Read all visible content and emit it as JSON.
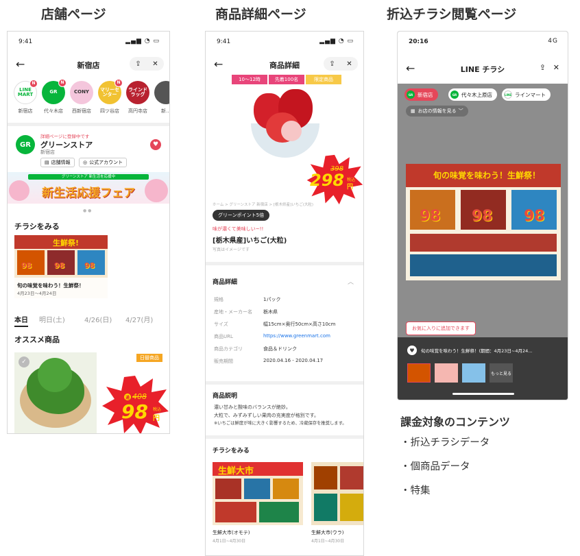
{
  "headers": {
    "store_page": "店舗ページ",
    "detail_page": "商品詳細ページ",
    "flyer_page": "折込チラシ閲覧ページ"
  },
  "store_page": {
    "status_time": "9:41",
    "title": "新宿店",
    "stores": [
      {
        "name": "LINE MART",
        "label": "新宿店",
        "color": "#ffffff",
        "text_color": "#07b53b",
        "badge": "N"
      },
      {
        "name": "GR",
        "label": "代々木店",
        "color": "#07b53b",
        "text_color": "#ffffff",
        "badge": "N"
      },
      {
        "name": "CONY",
        "label": "西新宿店",
        "color": "#f4c6dc",
        "text_color": "#333333",
        "badge": ""
      },
      {
        "name": "マリーセンター",
        "label": "四ツ谷店",
        "color": "#f1c232",
        "text_color": "#ffffff",
        "badge": "N"
      },
      {
        "name": "ラインドラッグ",
        "label": "高円寺店",
        "color": "#b8212f",
        "text_color": "#ffffff",
        "badge": ""
      },
      {
        "name": "",
        "label": "新…",
        "color": "#555555",
        "text_color": "#ffffff",
        "badge": ""
      }
    ],
    "shop_small": "詳細ページに登録中です",
    "shop_name": "グリーンストア",
    "shop_branch": "新宿店",
    "btn_store_info": "店舗情報",
    "btn_official": "公式アカウント",
    "banner_top": "グリーンストア 新生活を応援中",
    "banner_main": "新生活応援フェア",
    "flyer_section": "チラシをみる",
    "flyer_title": "旬の味覚を味わう！生鮮祭！",
    "flyer_dates": "4月23日～4月24日",
    "date_tabs": [
      "本日",
      "明日(土)",
      "4/26(日)",
      "4/27(月)"
    ],
    "recommend_section": "オススメ商品",
    "recommend_tag": "日替商品",
    "price_old": "408",
    "price_new": "98",
    "price_unit": "円",
    "tax_label": "税込"
  },
  "detail_page": {
    "status_time": "9:41",
    "title": "商品詳細",
    "tags": [
      "10～12時",
      "先着100名",
      "限定商品"
    ],
    "price_old": "398",
    "price_new": "298",
    "price_unit": "円",
    "tax_label": "税込",
    "breadcrumb": "ホーム > グリーンストア 新宿店 > [栃木県産]いちご(大粒)",
    "point_tag": "グリーンポイント5倍",
    "catch_copy": "味が濃くて美味しい~!!",
    "product_name": "[栃木県産]いちご(大粒)",
    "image_note": "写真はイメージです",
    "details_head": "商品詳細",
    "details": [
      {
        "k": "規格",
        "v": "1パック",
        "link": false
      },
      {
        "k": "産地・メーカー名",
        "v": "栃木県",
        "link": false
      },
      {
        "k": "サイズ",
        "v": "幅15cm×奥行50cm×高さ10cm",
        "link": false
      },
      {
        "k": "商品URL",
        "v": "https://www.greenmart.com",
        "link": true
      },
      {
        "k": "商品カテゴリ",
        "v": "食品＆ドリンク",
        "link": false
      },
      {
        "k": "販売期間",
        "v": "2020.04.16 - 2020.04.17",
        "link": false
      }
    ],
    "desc_head": "商品説明",
    "desc_lines": [
      "濃い甘みと酸味のバランスが絶妙。",
      "大粒で、みずみずしい果肉の充実度が格別です。",
      "※いちごは鮮度が味に大きく影響するため、冷蔵保存を推奨します。"
    ],
    "flyer_section": "チラシをみる",
    "flyers": [
      {
        "banner": "生鮮大市",
        "name": "生鮮大市(オモテ)",
        "dates": "4月1日~4月30日"
      },
      {
        "banner": "",
        "name": "生鮮大市(ウラ)",
        "dates": "4月1日~4月30日"
      }
    ]
  },
  "flyer_page": {
    "status_time": "20:16",
    "status_right": "4G",
    "title": "LINE チラシ",
    "chips": [
      {
        "label": "新宿店",
        "bg": "#e5475a",
        "fg": "#ffffff",
        "dot": "#07b53b",
        "dot_text": "GR"
      },
      {
        "label": "代々木上原店",
        "bg": "#ffffff",
        "fg": "#222222",
        "dot": "#07b53b",
        "dot_text": "GR"
      },
      {
        "label": "ラインマート",
        "bg": "#ffffff",
        "fg": "#222222",
        "dot": "#ffffff",
        "dot_text": "LINE"
      }
    ],
    "store_info_link": "お店の情報を見る",
    "flyer_banner": "旬の味覚を味わう！生鮮祭！",
    "price_big": "98",
    "tooltip": "お気に入りに追加できます",
    "bottom_title": "旬の味覚を味わう！生鮮祭！(期間：4月23日~4月24…",
    "more_label": "もっと見る"
  },
  "caption": {
    "title": "課金対象のコンテンツ",
    "items": [
      "・折込チラシデータ",
      "・個商品データ",
      "・特集"
    ]
  }
}
